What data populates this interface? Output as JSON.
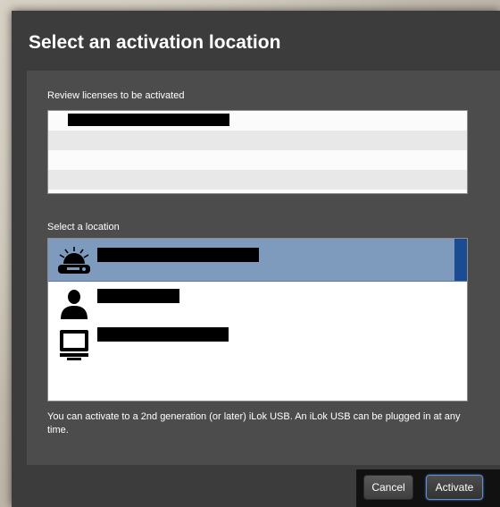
{
  "dialog": {
    "title": "Select an activation location",
    "licenses_label": "Review licenses to be activated",
    "location_label": "Select a location",
    "footnote": "You can activate to a 2nd generation (or later) iLok USB. An iLok USB can be plugged in at any time."
  },
  "locations": [
    {
      "icon": "ilok-usb-icon",
      "selected": true
    },
    {
      "icon": "user-icon",
      "selected": false
    },
    {
      "icon": "computer-icon",
      "selected": false
    }
  ],
  "buttons": {
    "cancel_label": "Cancel",
    "activate_label": "Activate"
  },
  "colors": {
    "selection": "#7e9bbd",
    "selection_accent": "#1a4b93",
    "focus_ring": "#5b8fd6"
  }
}
